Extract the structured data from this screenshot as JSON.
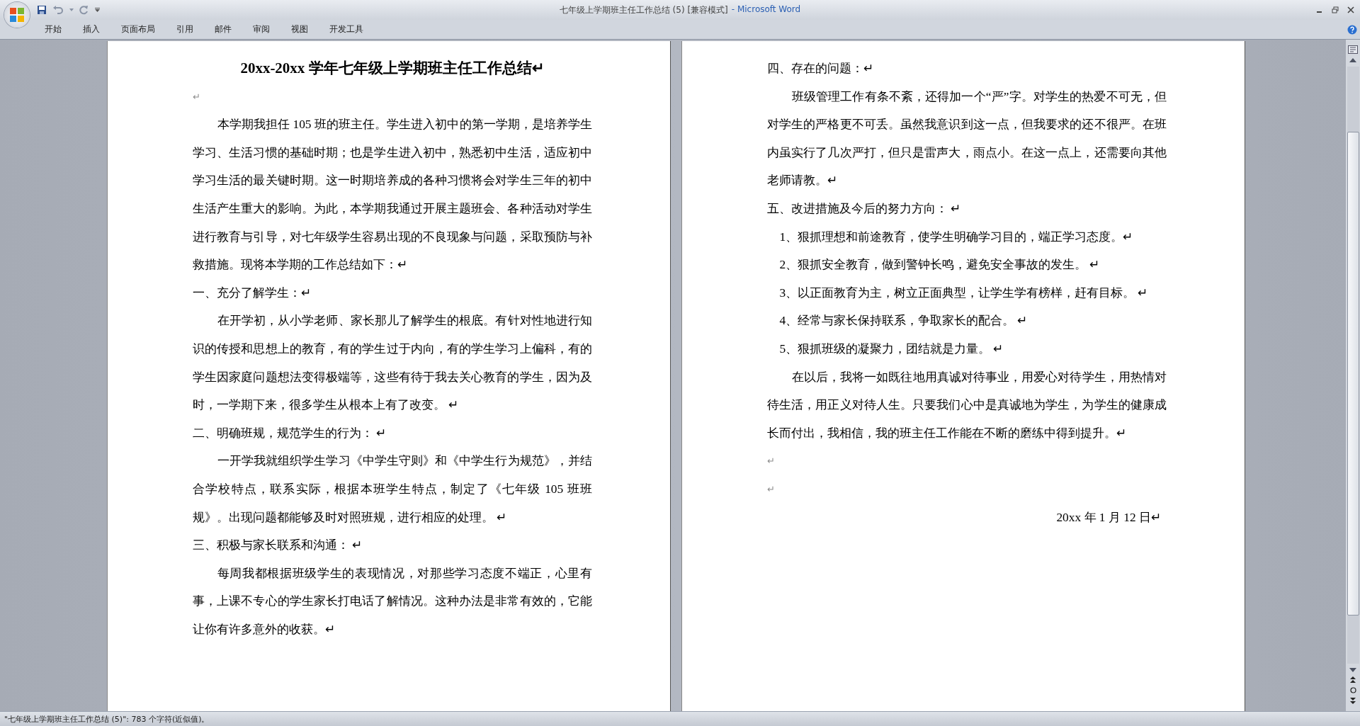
{
  "window": {
    "title": "七年级上学期班主任工作总结 (5) [兼容模式]",
    "app": "- Microsoft Word"
  },
  "tabs": [
    {
      "label": "开始",
      "selected": false
    },
    {
      "label": "插入",
      "selected": false
    },
    {
      "label": "页面布局",
      "selected": false
    },
    {
      "label": "引用",
      "selected": false
    },
    {
      "label": "邮件",
      "selected": false
    },
    {
      "label": "审阅",
      "selected": false
    },
    {
      "label": "视图",
      "selected": false
    },
    {
      "label": "开发工具",
      "selected": false
    }
  ],
  "pages": [
    {
      "paragraphs": [
        {
          "kind": "title",
          "text": "20xx-20xx 学年七年级上学期班主任工作总结↵"
        },
        {
          "kind": "blank",
          "text": "↵"
        },
        {
          "kind": "body",
          "text": "本学期我担任 105 班的班主任。学生进入初中的第一学期，是培养学生学习、生活习惯的基础时期；也是学生进入初中，熟悉初中生活，适应初中学习生活的最关键时期。这一时期培养成的各种习惯将会对学生三年的初中生活产生重大的影响。为此，本学期我通过开展主题班会、各种活动对学生进行教育与引导，对七年级学生容易出现的不良现象与问题，采取预防与补救措施。现将本学期的工作总结如下：↵"
        },
        {
          "kind": "heading",
          "text": "一、充分了解学生：↵"
        },
        {
          "kind": "body",
          "text": "在开学初，从小学老师、家长那儿了解学生的根底。有针对性地进行知识的传授和思想上的教育，有的学生过于内向，有的学生学习上偏科，有的学生因家庭问题想法变得极端等，这些有待于我去关心教育的学生，因为及时，一学期下来，很多学生从根本上有了改变。 ↵"
        },
        {
          "kind": "heading",
          "text": "二、明确班规，规范学生的行为： ↵"
        },
        {
          "kind": "body",
          "text": "一开学我就组织学生学习《中学生守则》和《中学生行为规范》，并结合学校特点，联系实际，根据本班学生特点，制定了《七年级 105 班班规》。出现问题都能够及时对照班规，进行相应的处理。 ↵"
        },
        {
          "kind": "heading",
          "text": "三、积极与家长联系和沟通： ↵"
        },
        {
          "kind": "body",
          "text": "每周我都根据班级学生的表现情况，对那些学习态度不端正，心里有事，上课不专心的学生家长打电话了解情况。这种办法是非常有效的，它能让你有许多意外的收获。↵"
        }
      ]
    },
    {
      "paragraphs": [
        {
          "kind": "heading",
          "text": "四、存在的问题：↵"
        },
        {
          "kind": "body",
          "text": "班级管理工作有条不紊，还得加一个“严”字。对学生的热爱不可无，但对学生的严格更不可丢。虽然我意识到这一点，但我要求的还不很严。在班内虽实行了几次严打，但只是雷声大，雨点小。在这一点上，还需要向其他老师请教。↵"
        },
        {
          "kind": "heading",
          "text": "五、改进措施及今后的努力方向： ↵"
        },
        {
          "kind": "item",
          "text": "1、狠抓理想和前途教育，使学生明确学习目的，端正学习态度。↵"
        },
        {
          "kind": "item",
          "text": "2、狠抓安全教育，做到警钟长鸣，避免安全事故的发生。 ↵"
        },
        {
          "kind": "item",
          "text": "3、以正面教育为主，树立正面典型，让学生学有榜样，赶有目标。 ↵"
        },
        {
          "kind": "item",
          "text": "4、经常与家长保持联系，争取家长的配合。 ↵"
        },
        {
          "kind": "item",
          "text": "5、狠抓班级的凝聚力，团结就是力量。 ↵"
        },
        {
          "kind": "body",
          "text": "在以后，我将一如既往地用真诚对待事业，用爱心对待学生，用热情对待生活，用正义对待人生。只要我们心中是真诚地为学生，为学生的健康成长而付出，我相信，我的班主任工作能在不断的磨练中得到提升。↵"
        },
        {
          "kind": "blank",
          "text": "↵"
        },
        {
          "kind": "blank",
          "text": "↵"
        },
        {
          "kind": "date",
          "text": "20xx 年 1 月 12 日↵"
        }
      ]
    }
  ],
  "status_bar": {
    "text": "\"七年级上学期班主任工作总结 (5)\": 783 个字符(近似值)。"
  }
}
